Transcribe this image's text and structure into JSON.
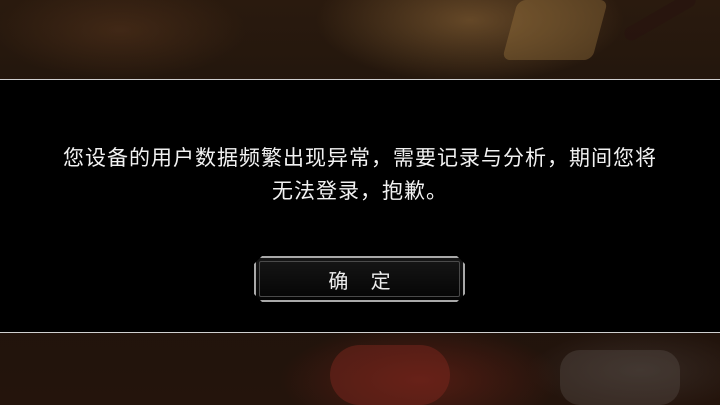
{
  "dialog": {
    "message": "您设备的用户数据频繁出现异常，需要记录与分析，期间您将无法登录，抱歉。",
    "confirm_label": "确 定"
  },
  "colors": {
    "band_background": "#000000",
    "band_border": "#cfcfcf",
    "text": "#f2f2f2",
    "button_border": "#a9a9a9"
  }
}
